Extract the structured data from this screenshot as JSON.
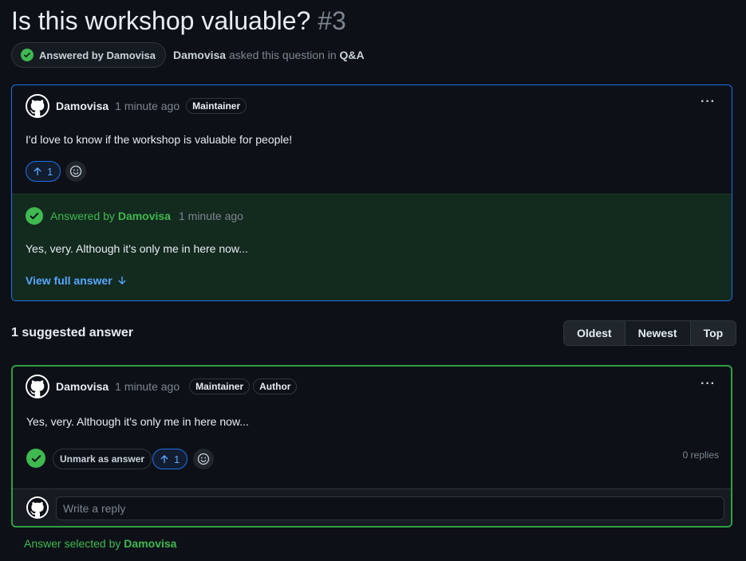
{
  "discussion": {
    "title": "Is this workshop valuable?",
    "number": "#3",
    "answered_label": "Answered by Damovisa",
    "asker": "Damovisa",
    "asked_text": "asked this question in",
    "category": "Q&A"
  },
  "question": {
    "author": "Damovisa",
    "time": "1 minute ago",
    "badge": "Maintainer",
    "body": "I'd love to know if the workshop is valuable for people!",
    "upvotes": "1",
    "answer_preview": {
      "answered_by_prefix": "Answered by",
      "answered_by": "Damovisa",
      "time": "1 minute ago",
      "body": "Yes, very. Although it's only me in here now...",
      "view_full": "View full answer"
    }
  },
  "answers_section": {
    "heading": "1 suggested answer",
    "sort_options": [
      "Oldest",
      "Newest",
      "Top"
    ],
    "active_sort": "Newest"
  },
  "answer": {
    "author": "Damovisa",
    "time": "1 minute ago",
    "badges": [
      "Maintainer",
      "Author"
    ],
    "body": "Yes, very. Although it's only me in here now...",
    "unmark_label": "Unmark as answer",
    "upvotes": "1",
    "replies": "0 replies",
    "reply_placeholder": "Write a reply",
    "selected_prefix": "Answer selected by",
    "selected_by": "Damovisa"
  },
  "colors": {
    "accent_blue": "#1f6feb",
    "success_green": "#3fb950",
    "background": "#0d1117"
  },
  "icons": [
    "check-circle-icon",
    "github-avatar-icon",
    "kebab-icon",
    "arrow-up-icon",
    "smiley-icon",
    "arrow-down-icon"
  ]
}
